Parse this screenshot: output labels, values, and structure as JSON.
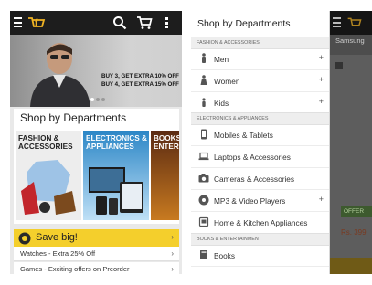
{
  "left": {
    "banner_line1": "BUY 3, GET EXTRA 10% OFF",
    "banner_line2": "BUY 4, GET EXTRA 15% OFF",
    "section_title": "Shop by Departments",
    "tiles": [
      {
        "line1": "FASHION &",
        "line2": "ACCESSORIES"
      },
      {
        "line1": "ELECTRONICS &",
        "line2": "APPLIANCES"
      },
      {
        "line1": "BOOKS",
        "line2": "ENTER"
      }
    ],
    "save_label": "Save big!",
    "links": [
      "Watches - Extra 25% Off",
      "Games - Exciting offers on Preorder"
    ]
  },
  "drawer": {
    "title": "Shop by Departments",
    "sections": [
      "FASHION & ACCESSORIES",
      "ELECTRONICS & APPLIANCES",
      "BOOKS & ENTERTAINMENT"
    ],
    "fashion_items": [
      "Men",
      "Women",
      "Kids"
    ],
    "electronics_items": [
      "Mobiles & Tablets",
      "Laptops & Accessories",
      "Cameras & Accessories",
      "MP3 & Video Players",
      "Home & Kitchen Appliances"
    ],
    "books_items": [
      "Books"
    ]
  },
  "sliver": {
    "title": "Samsung",
    "price": "Rs. 399",
    "badge": "OFFER"
  },
  "colors": {
    "topbar": "#1d1d1d",
    "accent": "#f4cf2c",
    "logo": "#f0b323"
  }
}
